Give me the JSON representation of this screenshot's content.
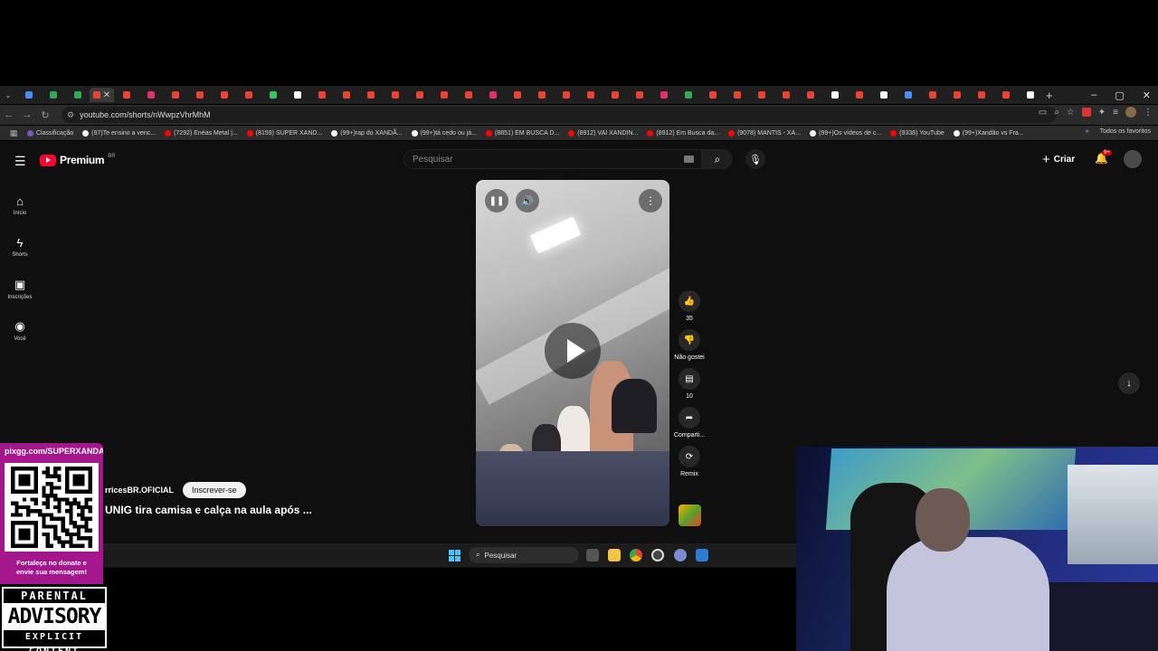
{
  "browser": {
    "url": "youtube.com/shorts/nWwpzVhrMhM",
    "bookmarks": [
      {
        "label": "Classificação",
        "color": "#7e57c2"
      },
      {
        "label": "(97)Te ensino a venc...",
        "color": "#ffffff"
      },
      {
        "label": "(7292) Enéas Metal |...",
        "color": "#ff0000"
      },
      {
        "label": "(8159) SUPER XAND...",
        "color": "#ff0000"
      },
      {
        "label": "(99+)rap do XANDÃ...",
        "color": "#ffffff"
      },
      {
        "label": "(99+)tá cedo ou já...",
        "color": "#ffffff"
      },
      {
        "label": "(8851) EM BUSCA D...",
        "color": "#ff0000"
      },
      {
        "label": "(8912) VAI XANDIN...",
        "color": "#ff0000"
      },
      {
        "label": "(8912) Em Busca da...",
        "color": "#ff0000"
      },
      {
        "label": "(9078) MANTIS - XA...",
        "color": "#ff0000"
      },
      {
        "label": "(99+)Os vídeos de c...",
        "color": "#ffffff"
      },
      {
        "label": "(9338) YouTube",
        "color": "#ff0000"
      },
      {
        "label": "(99+)Xandão vs Fra...",
        "color": "#ffffff"
      }
    ],
    "all_favorites": "Todos os favoritos"
  },
  "youtube": {
    "logo_text": "Premium",
    "logo_region": "BR",
    "search_placeholder": "Pesquisar",
    "create_label": "Criar",
    "notif_badge": "9+",
    "sidebar": [
      {
        "icon": "home-icon",
        "label": "Início"
      },
      {
        "icon": "shorts-icon",
        "label": "Shorts"
      },
      {
        "icon": "subscriptions-icon",
        "label": "Inscrições"
      },
      {
        "icon": "you-icon",
        "label": "Você"
      }
    ],
    "actions": [
      {
        "icon": "like-icon",
        "label": "35"
      },
      {
        "icon": "dislike-icon",
        "label": "Não gostei"
      },
      {
        "icon": "comment-icon",
        "label": "10"
      },
      {
        "icon": "share-icon",
        "label": "Comparti..."
      },
      {
        "icon": "remix-icon",
        "label": "Remix"
      }
    ],
    "channel_name": "rricesBR.OFICIAL",
    "subscribe_label": "Inscrever-se",
    "video_title": "UNIG tira camisa e calça na aula após ..."
  },
  "taskbar": {
    "search_placeholder": "Pesquisar"
  },
  "overlay": {
    "donate_url": "pixgg.com/SUPERXANDA",
    "donate_message_1": "Fortaleça no donate e",
    "donate_message_2": "envie sua mensagem!",
    "advisory_top": "PARENTAL",
    "advisory_mid": "ADVISORY",
    "advisory_bottom": "EXPLICIT CONTENT"
  }
}
